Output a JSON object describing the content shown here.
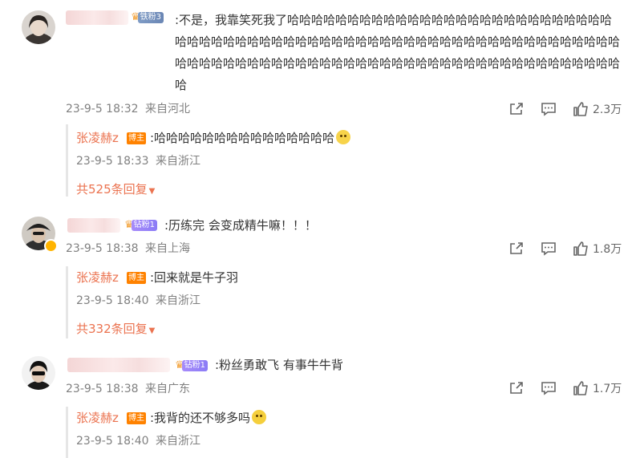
{
  "comments": [
    {
      "fan_badge": "铁粉3",
      "text": ":不是，我靠笑死我了哈哈哈哈哈哈哈哈哈哈哈哈哈哈哈哈哈哈哈哈哈哈哈哈哈哈哈哈哈哈哈哈哈哈哈哈哈哈哈哈哈哈哈哈哈哈哈哈哈哈哈哈哈哈哈哈哈哈哈哈哈哈哈哈哈哈哈哈哈哈哈哈哈哈哈哈哈哈哈哈哈哈哈哈哈哈哈哈哈哈哈哈哈哈哈哈哈哈哈哈哈哈",
      "time": "23-9-5 18:32",
      "location": "来自河北",
      "likes": "2.3万",
      "reply": {
        "author": "张凌赫z",
        "host_badge": "博主",
        "text": ":哈哈哈哈哈哈哈哈哈哈哈哈哈哈哈",
        "emoji": "smile-emoji",
        "time": "23-9-5 18:33",
        "location": "来自浙江"
      },
      "more_replies": "共525条回复"
    },
    {
      "fan_badge": "钻粉1",
      "text": ":历练完 会变成精牛嘛！！！",
      "time": "23-9-5 18:38",
      "location": "来自上海",
      "likes": "1.8万",
      "reply": {
        "author": "张凌赫z",
        "host_badge": "博主",
        "text": ":回来就是牛子羽",
        "time": "23-9-5 18:40",
        "location": "来自浙江"
      },
      "more_replies": "共332条回复"
    },
    {
      "fan_badge": "钻粉1",
      "text": ":粉丝勇敢飞 有事牛牛背",
      "time": "23-9-5 18:38",
      "location": "来自广东",
      "likes": "1.7万",
      "reply": {
        "author": "张凌赫z",
        "host_badge": "博主",
        "text": ":我背的还不够多吗",
        "emoji": "hug-emoji",
        "time": "23-9-5 18:40",
        "location": "来自浙江"
      }
    }
  ],
  "icons": {
    "share": "share-icon",
    "comment": "comment-icon",
    "like": "like-icon"
  },
  "colors": {
    "reply_name": "#eb7350",
    "host_badge": "#ff8200",
    "meta_text": "#808080"
  }
}
